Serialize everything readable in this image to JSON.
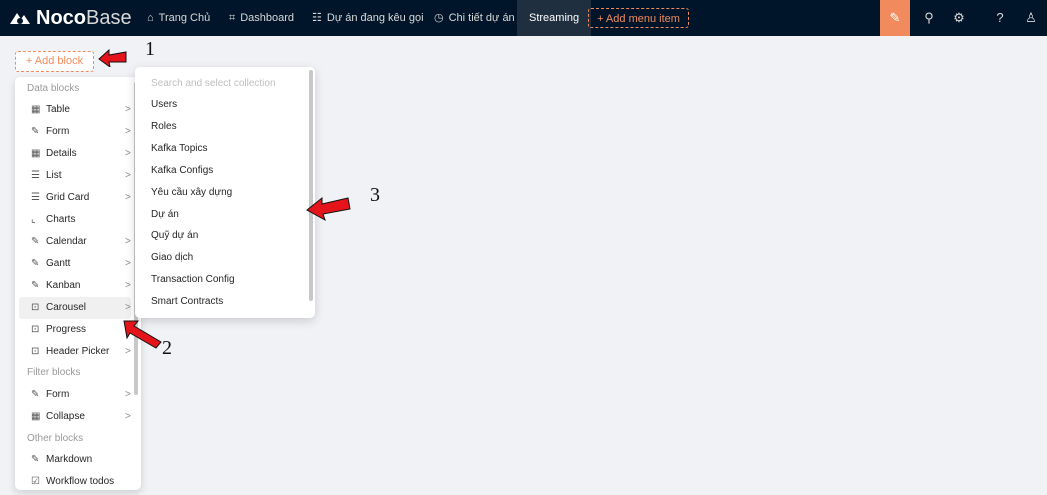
{
  "topbar": {
    "logo_bold": "Noco",
    "logo_thin": "Base",
    "menu": [
      {
        "label": "Trang Chủ",
        "icon": "bank-icon",
        "glyph": "⌂"
      },
      {
        "label": "Dashboard",
        "icon": "app-icon",
        "glyph": "⌗"
      },
      {
        "label": "Dự án đang kêu gọi",
        "icon": "message-icon",
        "glyph": "☷"
      },
      {
        "label": "Chi tiết dự án",
        "icon": "clock-icon",
        "glyph": "◷"
      }
    ],
    "active_tab": "Streaming",
    "add_menu_label": "+   Add menu item",
    "right_icons": [
      {
        "name": "design-icon",
        "glyph": "✎"
      },
      {
        "name": "plugin-icon",
        "glyph": "⚲"
      },
      {
        "name": "settings-icon",
        "glyph": "⚙"
      },
      {
        "name": "help-icon",
        "glyph": "?"
      },
      {
        "name": "user-icon",
        "glyph": "♙"
      }
    ],
    "background": "#001529",
    "accent": "#f18b5d"
  },
  "add_block_label": "+   Add block",
  "dropdown": {
    "groups": {
      "data": "Data blocks",
      "filter": "Filter blocks",
      "other": "Other blocks"
    },
    "items": [
      {
        "label": "Table",
        "icon": "table-icon",
        "glyph": "▦",
        "arrow": ">"
      },
      {
        "label": "Form",
        "icon": "form-icon",
        "glyph": "✎",
        "arrow": ">"
      },
      {
        "label": "Details",
        "icon": "table-icon",
        "glyph": "▦",
        "arrow": ">"
      },
      {
        "label": "List",
        "icon": "list-icon",
        "glyph": "☰",
        "arrow": ">"
      },
      {
        "label": "Grid Card",
        "icon": "list-icon",
        "glyph": "☰",
        "arrow": ">"
      },
      {
        "label": "Charts",
        "icon": "line-chart-icon",
        "glyph": "⌞",
        "arrow": ""
      },
      {
        "label": "Calendar",
        "icon": "form-icon",
        "glyph": "✎",
        "arrow": ">"
      },
      {
        "label": "Gantt",
        "icon": "form-icon",
        "glyph": "✎",
        "arrow": ">"
      },
      {
        "label": "Kanban",
        "icon": "form-icon",
        "glyph": "✎",
        "arrow": ">"
      },
      {
        "label": "Carousel",
        "icon": "code-icon",
        "glyph": "⊡",
        "arrow": ">"
      },
      {
        "label": "Progress",
        "icon": "code-icon",
        "glyph": "⊡",
        "arrow": ">"
      },
      {
        "label": "Header Picker",
        "icon": "code-icon",
        "glyph": "⊡",
        "arrow": ">"
      },
      {
        "label": "Form",
        "icon": "form-icon",
        "glyph": "✎",
        "arrow": ">"
      },
      {
        "label": "Collapse",
        "icon": "table-icon",
        "glyph": "▦",
        "arrow": ">"
      },
      {
        "label": "Markdown",
        "icon": "form-icon",
        "glyph": "✎",
        "arrow": ""
      },
      {
        "label": "Workflow todos",
        "icon": "check-icon",
        "glyph": "☑",
        "arrow": ""
      }
    ]
  },
  "submenu": {
    "search_placeholder": "Search and select collection",
    "items": [
      "Users",
      "Roles",
      "Kafka Topics",
      "Kafka Configs",
      "Yêu cầu xây dựng",
      "Dự án",
      "Quỹ dự án",
      "Giao dịch",
      "Transaction Config",
      "Smart Contracts"
    ]
  },
  "annotations": [
    "1",
    "2",
    "3"
  ]
}
